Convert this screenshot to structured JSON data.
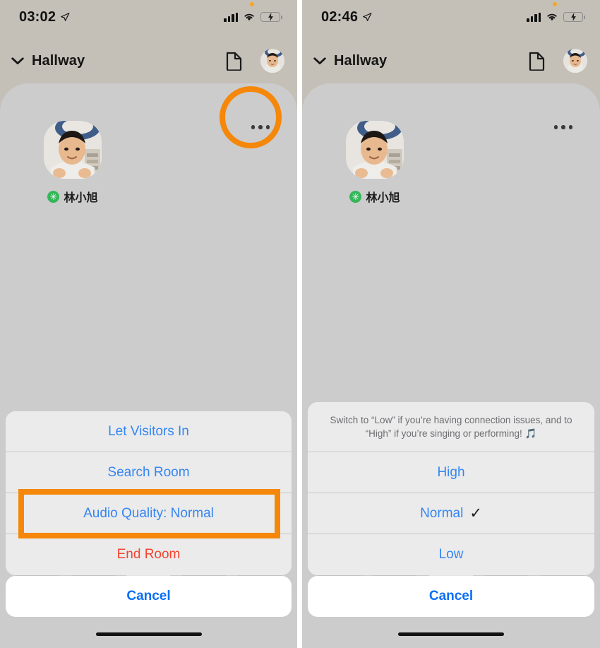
{
  "panels": [
    {
      "status_bar": {
        "time": "03:02",
        "location_icon": "location-arrow-icon",
        "signal_icon": "cellular-signal-icon",
        "wifi_icon": "wifi-icon",
        "battery_icon": "battery-charging-icon",
        "battery_color": "#4cd964",
        "notification_dot_color": "#f5a623"
      },
      "nav_bar": {
        "chevron_icon": "chevron-down-icon",
        "room_title": "Hallway",
        "document_icon": "document-icon",
        "avatar": "user-avatar"
      },
      "room": {
        "more_icon": "ellipsis-icon",
        "speaker": {
          "name": "林小旭",
          "badge_glyph": "✳",
          "badge_color": "#34b759"
        }
      },
      "action_sheet": {
        "header": "",
        "rows": [
          {
            "label": "Let Visitors In",
            "style": "default",
            "check": ""
          },
          {
            "label": "Search Room",
            "style": "default",
            "check": ""
          },
          {
            "label": "Audio Quality: Normal",
            "style": "default",
            "check": ""
          },
          {
            "label": "End Room",
            "style": "destructive",
            "check": ""
          }
        ]
      },
      "cancel_label": "Cancel",
      "annotations": {
        "more_circle_color": "#f5870a",
        "row_rect_color": "#f5870a",
        "row_rect_index": 2
      }
    },
    {
      "status_bar": {
        "time": "02:46",
        "location_icon": "location-arrow-icon",
        "signal_icon": "cellular-signal-icon",
        "wifi_icon": "wifi-icon",
        "battery_icon": "battery-charging-icon",
        "battery_color": "#4cd964",
        "notification_dot_color": "#f5a623"
      },
      "nav_bar": {
        "chevron_icon": "chevron-down-icon",
        "room_title": "Hallway",
        "document_icon": "document-icon",
        "avatar": "user-avatar"
      },
      "room": {
        "more_icon": "ellipsis-icon",
        "speaker": {
          "name": "林小旭",
          "badge_glyph": "✳",
          "badge_color": "#34b759"
        }
      },
      "action_sheet": {
        "header": "Switch to “Low” if you’re having connection issues, and to “High” if you’re singing or performing! 🎵",
        "rows": [
          {
            "label": "High",
            "style": "default",
            "check": ""
          },
          {
            "label": "Normal",
            "style": "default",
            "check": "✓"
          },
          {
            "label": "Low",
            "style": "default",
            "check": ""
          }
        ]
      },
      "cancel_label": "Cancel",
      "annotations": {}
    }
  ]
}
